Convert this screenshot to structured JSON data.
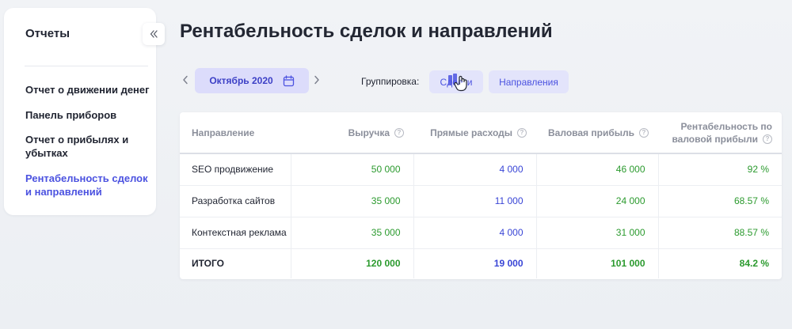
{
  "sidebar": {
    "title": "Отчеты",
    "items": [
      {
        "label": "Отчет о движении денег"
      },
      {
        "label": "Панель приборов"
      },
      {
        "label": "Отчет о прибылях и убытках"
      },
      {
        "label": "Рентабельность сделок и направлений",
        "active": true
      }
    ]
  },
  "main": {
    "title": "Рентабельность сделок и направлений",
    "period": {
      "label": "Октябрь 2020"
    },
    "grouping": {
      "label": "Группировка:",
      "options": [
        {
          "label": "Сделки",
          "selected": true
        },
        {
          "label": "Направления",
          "selected": false
        }
      ]
    },
    "table": {
      "columns": [
        {
          "label": "Направление"
        },
        {
          "label": "Выручка"
        },
        {
          "label": "Прямые расходы"
        },
        {
          "label": "Валовая прибыль"
        },
        {
          "label": "Рентабельность по",
          "label2": "валовой прибыли"
        }
      ],
      "rows": [
        {
          "name": "SEO продвижение",
          "revenue": "50 000",
          "costs": "4 000",
          "gross": "46 000",
          "margin": "92 %"
        },
        {
          "name": "Разработка сайтов",
          "revenue": "35 000",
          "costs": "11 000",
          "gross": "24 000",
          "margin": "68.57 %"
        },
        {
          "name": "Контекстная реклама",
          "revenue": "35 000",
          "costs": "4 000",
          "gross": "31 000",
          "margin": "88.57 %"
        }
      ],
      "total": {
        "name": "ИТОГО",
        "revenue": "120 000",
        "costs": "19 000",
        "gross": "101 000",
        "margin": "84.2 %"
      }
    }
  },
  "icons": {
    "collapse": "double-chevron-left-icon",
    "calendar": "calendar-icon",
    "help": "question-circle-icon",
    "cursor": "hand-pointer-icon"
  },
  "colors": {
    "accent": "#4b52e0",
    "accent_bg": "#dcdcfb",
    "positive": "#2b9a2e",
    "cost": "#3a46d6"
  }
}
